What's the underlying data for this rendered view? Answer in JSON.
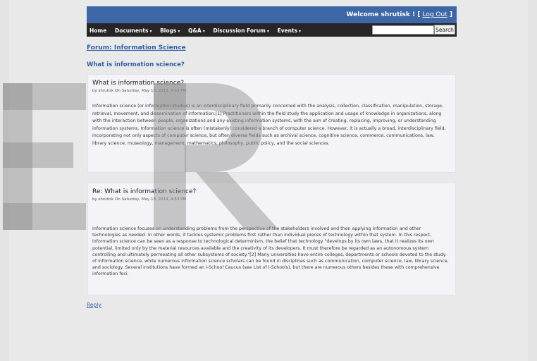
{
  "header": {
    "welcome_prefix": "Welcome",
    "username": "shrutisk",
    "separator_open": "! [",
    "logout_label": "Log Out",
    "separator_close": "]"
  },
  "nav": {
    "items": [
      {
        "label": "Home",
        "has_dropdown": false
      },
      {
        "label": "Documents",
        "has_dropdown": true
      },
      {
        "label": "Blogs",
        "has_dropdown": true
      },
      {
        "label": "Q&A",
        "has_dropdown": true
      },
      {
        "label": "Discussion Forum",
        "has_dropdown": true
      },
      {
        "label": "Events",
        "has_dropdown": true
      }
    ],
    "dropdown_caret": "▾",
    "search_value": "",
    "search_button_label": "Search"
  },
  "breadcrumb": "Forum: Information Science",
  "page_title": "What is information science?",
  "posts": [
    {
      "title": "What is information science?",
      "meta": "by shrutisk On Saturday, May 18, 2013, 4:53 PM",
      "body": "Information science (or information studies) is an interdisciplinary field primarily concerned with the analysis, collection, classification, manipulation, storage, retrieval, movement, and dissemination of information.[1] Practitioners within the field study the application and usage of knowledge in organizations, along with the interaction between people, organizations and any existing information systems, with the aim of creating, replacing, improving, or understanding information systems. Information science is often (mistakenly) considered a branch of computer science. However, it is actually a broad, interdisciplinary field, incorporating not only aspects of computer science, but often diverse fields such as archival science, cognitive science, commerce, communications, law, library science, museology, management, mathematics, philosophy, public policy, and the social sciences."
    },
    {
      "title": "Re: What is information science?",
      "meta": "by shrutisk On Saturday, May 18, 2013, 4:53 PM",
      "body": "Information science focuses on understanding problems from the perspective of the stakeholders involved and then applying information and other technologies as needed. In other words, it tackles systemic problems first rather than individual pieces of technology within that system. In this respect, information science can be seen as a response to technological determinism, the belief that technology \"develops by its own laws, that it realizes its own potential, limited only by the material resources available and the creativity of its developers. It must therefore be regarded as an autonomous system controlling and ultimately permeating all other subsystems of society.\"[2] Many universities have entire colleges, departments or schools devoted to the study of information science, while numerous information science scholars can be found in disciplines such as communication, computer science, law, library science, and sociology. Several institutions have formed an I-School Caucus (see List of I-Schools), but there are numerous others besides these with comprehensive information foci."
    }
  ],
  "reply_label": "Reply",
  "colors": {
    "header_bg": "#3e67a8",
    "nav_bg": "#262626",
    "link": "#2f5fa8",
    "watermark": "#8c8c8c"
  }
}
